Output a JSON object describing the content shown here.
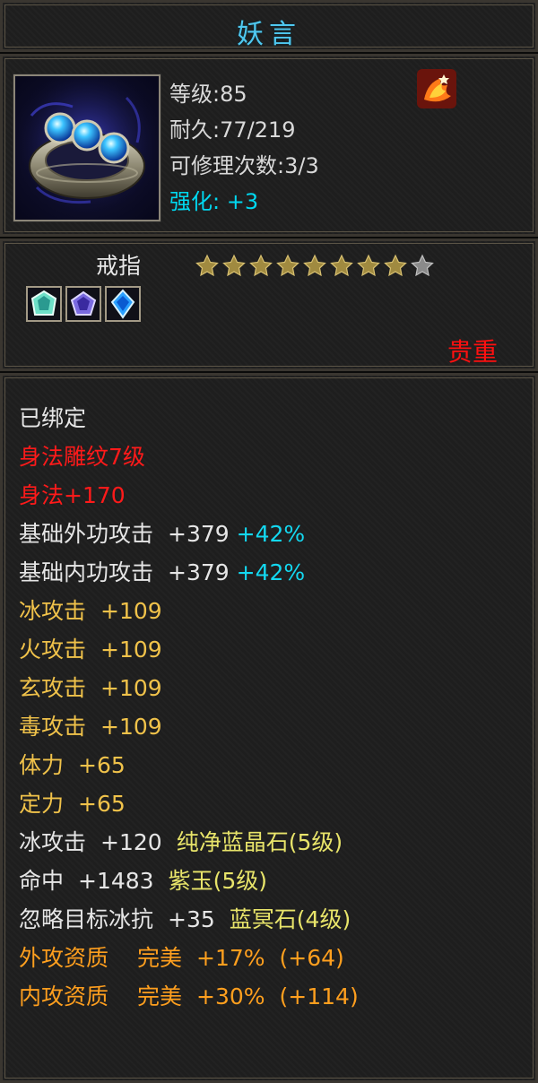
{
  "item": {
    "name": "妖言",
    "level": "等级:85",
    "durability": "耐久:77/219",
    "repair": "可修理次数:3/3",
    "enhance_label": "强化:",
    "enhance_value": "+3",
    "type": "戒指",
    "stars_filled": 8,
    "stars_total": 9,
    "rarity": "贵重",
    "colors": {
      "title": "#4fc8f0",
      "rarity": "#ff1010",
      "cyan": "#13d8f0",
      "red": "#ff1a1a",
      "orange": "#ff9f1e",
      "gold": "#f0c24a"
    },
    "icons": [
      "ring-icon",
      "fire-phoenix-icon",
      "green-gem-icon",
      "purple-gem-icon",
      "blue-gem-icon",
      "star-icon"
    ]
  },
  "attributes": {
    "bound": "已绑定",
    "engrave": "身法雕纹7级",
    "agility": "身法+170",
    "ext_attack": {
      "label": "基础外功攻击",
      "value": "+379",
      "pct": "+42%"
    },
    "int_attack": {
      "label": "基础内功攻击",
      "value": "+379",
      "pct": "+42%"
    },
    "ice_attack": {
      "label": "冰攻击",
      "value": "+109"
    },
    "fire_attack": {
      "label": "火攻击",
      "value": "+109"
    },
    "mystic_attack": {
      "label": "玄攻击",
      "value": "+109"
    },
    "poison_attack": {
      "label": "毒攻击",
      "value": "+109"
    },
    "stamina": {
      "label": "体力",
      "value": "+65"
    },
    "focus": {
      "label": "定力",
      "value": "+65"
    },
    "gem1": {
      "label": "冰攻击",
      "value": "+120",
      "gem": "纯净蓝晶石(5级)"
    },
    "gem2": {
      "label": "命中",
      "value": "+1483",
      "gem": "紫玉(5级)"
    },
    "gem3": {
      "label": "忽略目标冰抗",
      "value": "+35",
      "gem": "蓝冥石(4级)"
    },
    "q1": {
      "label": "外攻资质",
      "grade": "完美",
      "pct": "+17%",
      "extra": "(+64)"
    },
    "q2": {
      "label": "内攻资质",
      "grade": "完美",
      "pct": "+30%",
      "extra": "(+114)"
    }
  }
}
